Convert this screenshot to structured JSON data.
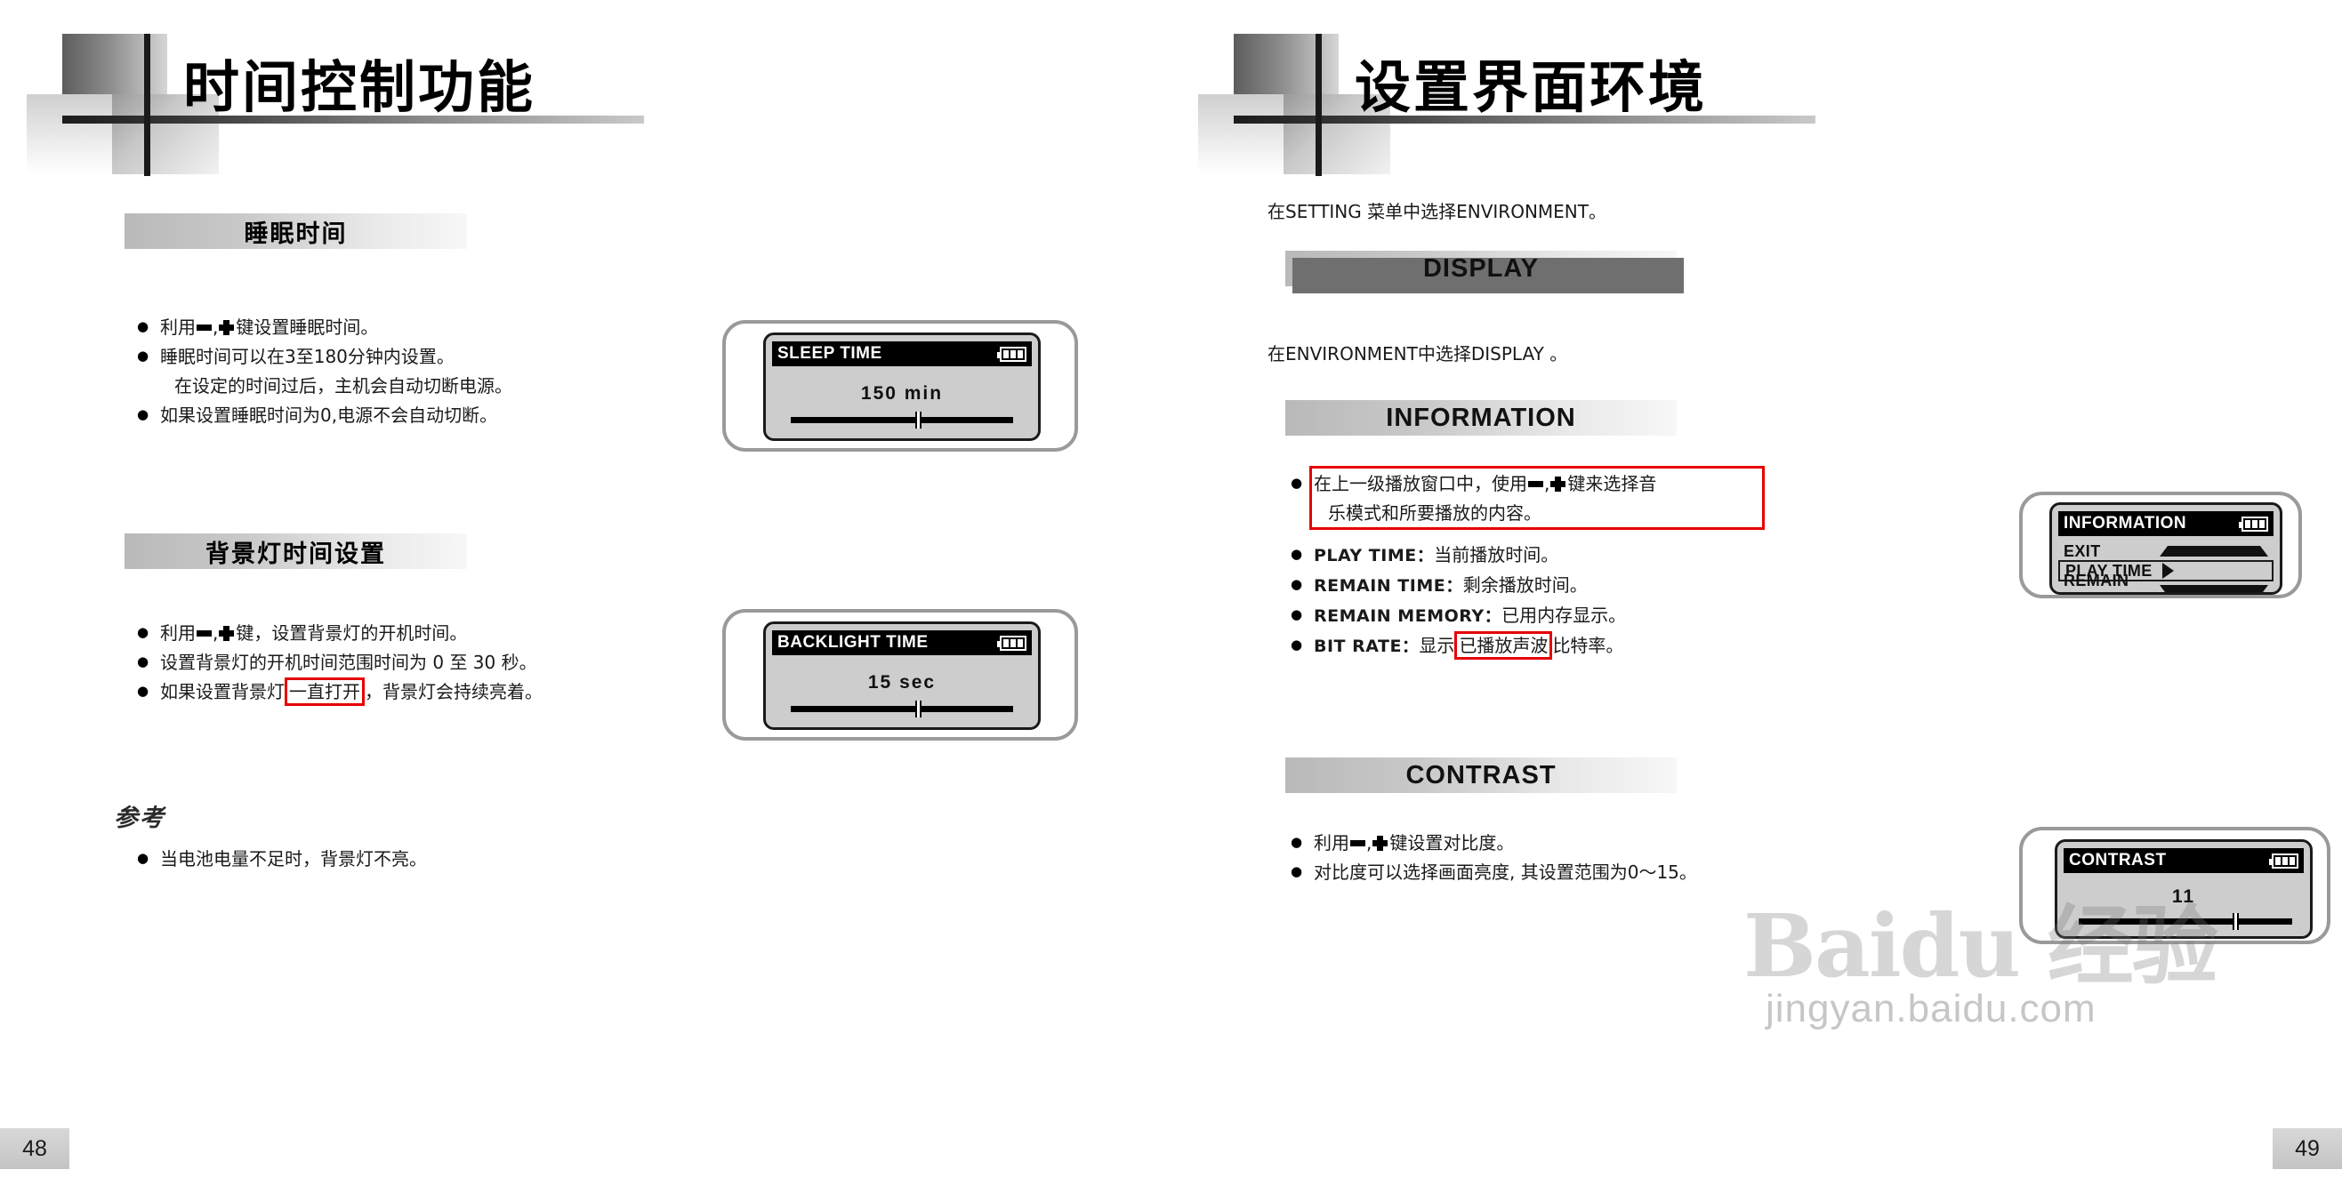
{
  "left_page": {
    "chapter_title": "时间控制功能",
    "page_number": "48",
    "sections": [
      {
        "banner": "睡眠时间",
        "bullets": [
          {
            "prefix": "利用",
            "mid": "键设置睡眠时间。",
            "keys": true
          },
          {
            "text": "睡眠时间可以在3至180分钟内设置。"
          },
          {
            "text": "在设定的时间过后，主机会自动切断电源。",
            "continuation": true
          },
          {
            "text": "如果设置睡眠时间为0,电源不会自动切断。"
          }
        ],
        "lcd": {
          "title": "SLEEP TIME",
          "value": "150  min",
          "thumb_percent": 57
        }
      },
      {
        "banner": "背景灯时间设置",
        "bullets": [
          {
            "prefix": "利用",
            "mid": "键，设置背景灯的开机时间。",
            "keys": true
          },
          {
            "text": "设置背景灯的开机时间范围时间为 0 至 30 秒。"
          },
          {
            "text_before": "如果设置背景灯",
            "highlight": "一直打开",
            "text_after": "，背景灯会持续亮着。"
          }
        ],
        "lcd": {
          "title": "BACKLIGHT TIME",
          "value": "15  sec",
          "thumb_percent": 57
        }
      }
    ],
    "reference": {
      "title": "参考",
      "bullets": [
        "当电池电量不足时，背景灯不亮。"
      ]
    }
  },
  "right_page": {
    "chapter_title": "设置界面环境",
    "page_number": "49",
    "intro": "在SETTING 菜单中选择ENVIRONMENT。",
    "display_banner": "DISPLAY",
    "display_intro": "在ENVIRONMENT中选择DISPLAY 。",
    "information": {
      "banner": "INFORMATION",
      "boxed_bullet": {
        "line1_before": "在上一级播放窗口中，使用",
        "line1_after": "键来选择音",
        "line2": "乐模式和所要播放的内容。"
      },
      "bullets": [
        {
          "label": "PLAY TIME：",
          "text": "当前播放时间。"
        },
        {
          "label": "REMAIN TIME：",
          "text": "剩余播放时间。"
        },
        {
          "label": "REMAIN MEMORY：",
          "text": "已用内存显示。"
        },
        {
          "label": "BIT RATE：",
          "text_before": "显示",
          "highlight": "已播放声波",
          "text_after": "比特率。"
        }
      ],
      "lcd": {
        "title": "INFORMATION",
        "rows": [
          {
            "label": "EXIT",
            "arrow": "arrow-up-icon",
            "selected": false
          },
          {
            "label": "PLAY TIME",
            "arrow": "arrow-right-icon",
            "selected": true
          },
          {
            "label": "REMAIN TIME",
            "arrow": "arrow-down-icon",
            "selected": false
          }
        ]
      }
    },
    "contrast": {
      "banner": "CONTRAST",
      "bullets": [
        {
          "prefix": "利用",
          "mid": "键设置对比度。",
          "keys": true
        },
        {
          "text": "对比度可以选择画面亮度, 其设置范围为0～15。"
        }
      ],
      "lcd": {
        "title": "CONTRAST",
        "value": "11",
        "thumb_percent": 73
      }
    }
  },
  "watermark": {
    "logo": "Baidu 经验",
    "url": "jingyan.baidu.com"
  }
}
